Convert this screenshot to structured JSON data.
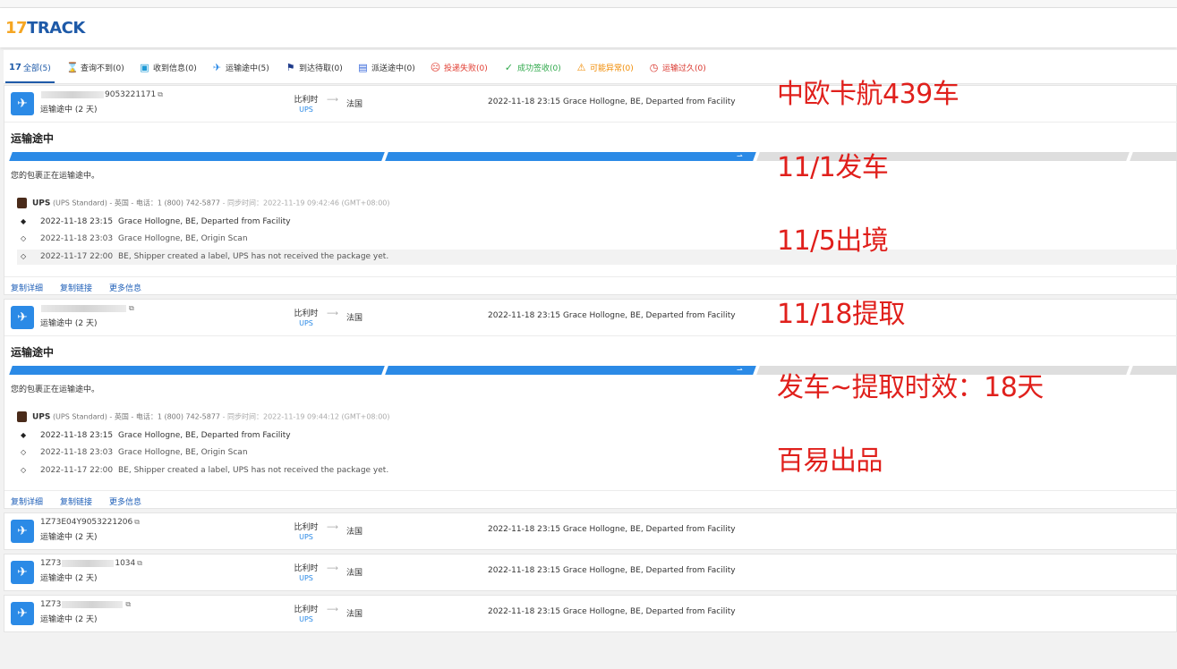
{
  "header": {
    "logo_part1": "17",
    "logo_part2": "TRACK"
  },
  "filters": [
    {
      "icon": "17-icon",
      "glyph": "17",
      "label": "全部(5)",
      "color": "#1e5aa8"
    },
    {
      "icon": "hourglass-icon",
      "glyph": "⌛",
      "label": "查询不到(0)",
      "color": "#666666"
    },
    {
      "icon": "info-icon",
      "glyph": "▣",
      "label": "收到信息(0)",
      "color": "#1e9ad6"
    },
    {
      "icon": "plane-icon",
      "glyph": "✈",
      "label": "运输途中(5)",
      "color": "#2b8ae6"
    },
    {
      "icon": "flag-icon",
      "glyph": "⚑",
      "label": "到达待取(0)",
      "color": "#1e3a8a"
    },
    {
      "icon": "delivery-icon",
      "glyph": "▤",
      "label": "派送途中(0)",
      "color": "#2b5fd9"
    },
    {
      "icon": "sad-face-icon",
      "glyph": "☹",
      "label": "投递失败(0)",
      "color": "#e03a2e"
    },
    {
      "icon": "check-icon",
      "glyph": "✓",
      "label": "成功签收(0)",
      "color": "#2ea84a"
    },
    {
      "icon": "warning-icon",
      "glyph": "⚠",
      "label": "可能异常(0)",
      "color": "#f08a00"
    },
    {
      "icon": "clock-icon",
      "glyph": "◷",
      "label": "运输过久(0)",
      "color": "#d9342b"
    }
  ],
  "shipments": [
    {
      "number_start": "",
      "number_end": "9053221171",
      "status": "运输途中 (2 天)",
      "origin": "比利时",
      "carrier": "UPS",
      "destination": "法国",
      "latest": "2022-11-18 23:15  Grace Hollogne, BE, Departed from Facility"
    },
    {
      "number_start": "",
      "number_end": "",
      "status": "运输途中 (2 天)",
      "origin": "比利时",
      "carrier": "UPS",
      "destination": "法国",
      "latest": "2022-11-18 23:15  Grace Hollogne, BE, Departed from Facility"
    },
    {
      "number_start": "1Z73E04Y",
      "number_end": "9053221206",
      "status": "运输途中 (2 天)",
      "origin": "比利时",
      "carrier": "UPS",
      "destination": "法国",
      "latest": "2022-11-18 23:15  Grace Hollogne, BE, Departed from Facility"
    },
    {
      "number_start": "1Z73",
      "number_end": "1034",
      "status": "运输途中 (2 天)",
      "origin": "比利时",
      "carrier": "UPS",
      "destination": "法国",
      "latest": "2022-11-18 23:15  Grace Hollogne, BE, Departed from Facility"
    },
    {
      "number_start": "1Z73",
      "number_end": "",
      "status": "运输途中 (2 天)",
      "origin": "比利时",
      "carrier": "UPS",
      "destination": "法国",
      "latest": "2022-11-18 23:15  Grace Hollogne, BE, Departed from Facility"
    }
  ],
  "details": [
    {
      "title": "运输途中",
      "desc": "您的包裹正在运输途中。",
      "carrier_name": "UPS",
      "carrier_info": "(UPS Standard) - 英国 - 电话：1 (800) 742-5877",
      "sync": " - 同步时间：2022-11-19 09:42:46 (GMT+08:00)",
      "events": [
        {
          "time": "2022-11-18 23:15",
          "msg": "Grace Hollogne, BE, Departed from Facility"
        },
        {
          "time": "2022-11-18 23:03",
          "msg": "Grace Hollogne, BE, Origin Scan"
        },
        {
          "time": "2022-11-17 22:00",
          "msg": "BE, Shipper created a label, UPS has not received the package yet."
        }
      ],
      "actions": [
        "复制详细",
        "复制链接",
        "更多信息"
      ]
    },
    {
      "title": "运输途中",
      "desc": "您的包裹正在运输途中。",
      "carrier_name": "UPS",
      "carrier_info": "(UPS Standard) - 英国 - 电话：1 (800) 742-5877",
      "sync": " - 同步时间：2022-11-19 09:44:12 (GMT+08:00)",
      "events": [
        {
          "time": "2022-11-18 23:15",
          "msg": "Grace Hollogne, BE, Departed from Facility"
        },
        {
          "time": "2022-11-18 23:03",
          "msg": "Grace Hollogne, BE, Origin Scan"
        },
        {
          "time": "2022-11-17 22:00",
          "msg": "BE, Shipper created a label, UPS has not received the package yet."
        }
      ],
      "actions": [
        "复制详细",
        "复制链接",
        "更多信息"
      ]
    }
  ],
  "annotations": [
    "中欧卡航439车",
    "11/1发车",
    "11/5出境",
    "11/18提取",
    "发车~提取时效：18天",
    "百易出品"
  ],
  "colors": {
    "accent": "#2b8ae6",
    "brand_blue": "#1e5aa8",
    "brand_orange": "#f5a623",
    "annotation_red": "#e0201c"
  }
}
